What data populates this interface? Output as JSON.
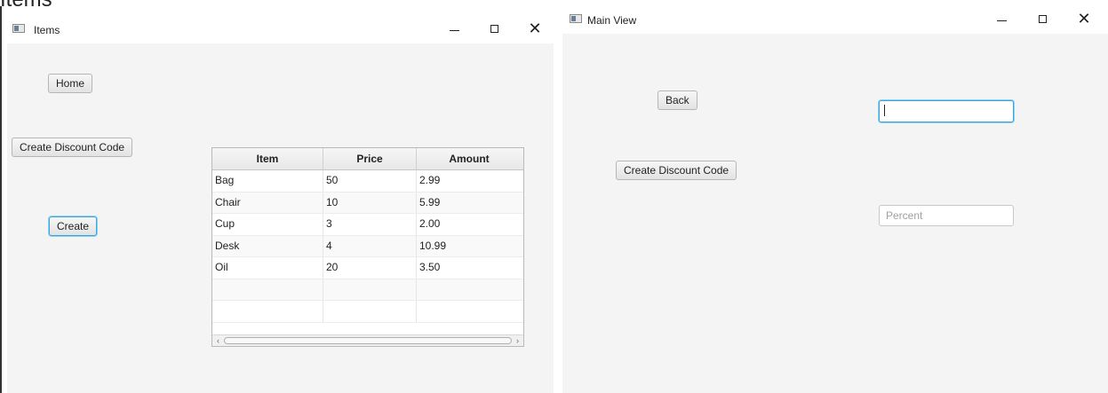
{
  "cropped_heading": "Items",
  "items_window": {
    "title": "Items",
    "home_button": "Home",
    "create_discount_button": "Create Discount Code",
    "create_button": "Create",
    "table": {
      "columns": [
        "Item",
        "Price",
        "Amount"
      ],
      "rows": [
        [
          "Bag",
          "50",
          "2.99"
        ],
        [
          "Chair",
          "10",
          "5.99"
        ],
        [
          "Cup",
          "3",
          "2.00"
        ],
        [
          "Desk",
          "4",
          "10.99"
        ],
        [
          "Oil",
          "20",
          "3.50"
        ]
      ],
      "scroll_left": "‹",
      "scroll_right": "›"
    }
  },
  "main_window": {
    "title": "Main View",
    "back_button": "Back",
    "create_discount_button": "Create Discount Code",
    "code_input": {
      "value": "",
      "placeholder": ""
    },
    "percent_input": {
      "value": "",
      "placeholder": "Percent"
    }
  },
  "window_controls": {
    "close": "✕"
  },
  "colors": {
    "window_bg": "#f4f4f4",
    "focus": "#3ba4d8",
    "titlebar": "#ffffff"
  }
}
